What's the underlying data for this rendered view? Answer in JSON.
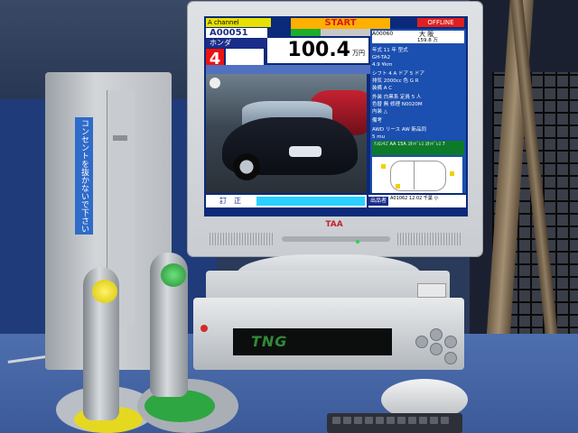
{
  "screen": {
    "channel_label": "A channel",
    "start_label": "START",
    "offline_label": "OFFLINE",
    "lot_number": "A00051",
    "maker": "ホンダ",
    "count": "4",
    "price": "100.4",
    "price_unit": "万円",
    "fix_button": "訂　正",
    "info_lot": "A00060",
    "info_city": "大 阪",
    "info_mileage": "159.8 万",
    "info_rows": [
      "年式 11 年   型式",
      "GH-TA2",
      "4.9 ¥km",
      "シフト 4 A    ドア 5 ドア",
      "排気 2000cc   色 G R",
      "装備 A C",
      "外装 白黒系    定員 5 人",
      "色替 無   修理 N0020M",
      "内装 △",
      "備考",
      "AWD リース AW 新品同",
      "5 mu"
    ],
    "green_note": "ﾃﾝﾛﾝｷｽﾞAA 15A ｽﾀｯﾄﾞﾚｽ ｽﾀｯﾄﾞﾚｽ 7",
    "exhibit_label": "出品者",
    "exhibit_text": "A01062 12:02 千葉 小",
    "monitor_brand": "TAA",
    "console_display": "TNG"
  },
  "pc": {
    "sticker_text": "コンセントを抜かないで下さい"
  },
  "colors": {
    "screen_bg": "#0b2a7a",
    "start_bg": "#ffb000",
    "offline_bg": "#e02020",
    "price_count_bg": "#e11",
    "joystick_left_cap": "#e8d400",
    "joystick_right_cap": "#1f8f31"
  }
}
